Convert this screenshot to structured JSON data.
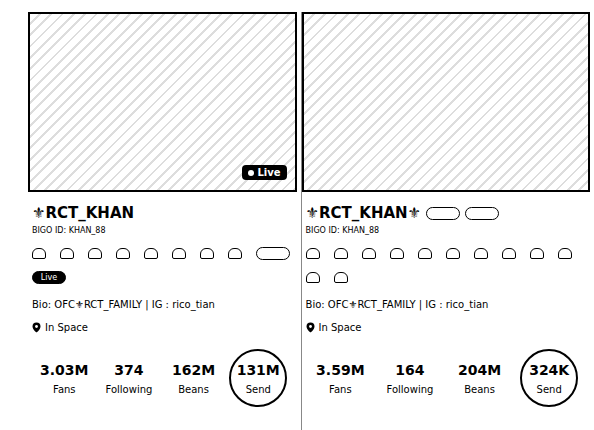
{
  "cards": [
    {
      "live_badge": "Live",
      "name": "⚜RCT_KHAN",
      "bigo_id": "BIGO ID: KHAN_88",
      "pills": [
        {
          "label": "",
          "dark": false
        },
        {
          "label": "Live",
          "dark": true
        }
      ],
      "badge_count": 8,
      "bio": "Bio: OFC⚜RCT_FAMILY | IG : rico_tian",
      "location": "In Space",
      "stats": [
        {
          "value": "3.03M",
          "label": "Fans",
          "circled": false
        },
        {
          "value": "374",
          "label": "Following",
          "circled": false
        },
        {
          "value": "162M",
          "label": "Beans",
          "circled": false
        },
        {
          "value": "131M",
          "label": "Send",
          "circled": true
        }
      ]
    },
    {
      "live_badge": "",
      "name": "⚜RCT_KHAN⚜",
      "bigo_id": "BIGO ID: KHAN_88",
      "pills": [
        {
          "label": "",
          "dark": false
        },
        {
          "label": "",
          "dark": false
        }
      ],
      "badge_count": 12,
      "bio": "Bio: OFC⚜RCT_FAMILY | IG : rico_tian",
      "location": "In Space",
      "stats": [
        {
          "value": "3.59M",
          "label": "Fans",
          "circled": false
        },
        {
          "value": "164",
          "label": "Following",
          "circled": false
        },
        {
          "value": "204M",
          "label": "Beans",
          "circled": false
        },
        {
          "value": "324K",
          "label": "Send",
          "circled": true
        }
      ]
    }
  ]
}
